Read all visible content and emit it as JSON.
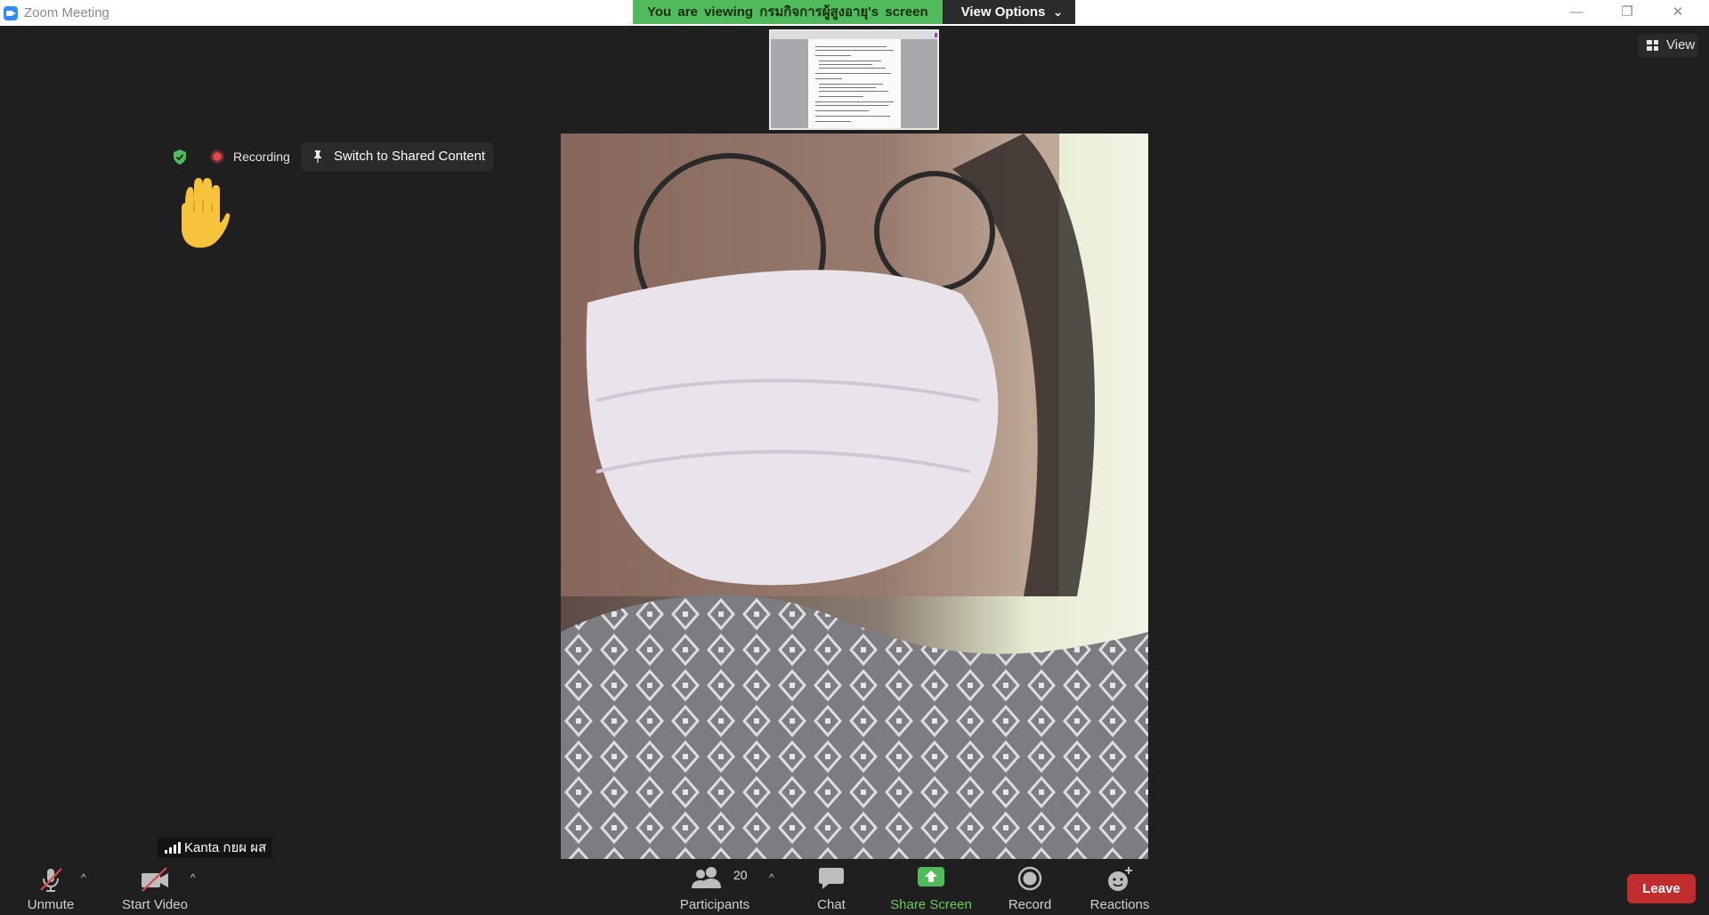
{
  "window": {
    "title": "Zoom Meeting",
    "controls": {
      "minimize": "—",
      "restore": "❐",
      "close": "✕"
    }
  },
  "share_banner": {
    "viewing_text": "You are viewing กรมกิจการผู้สูงอายุ's screen",
    "view_options_label": "View Options",
    "view_options_caret": "⌄"
  },
  "top_right": {
    "view_label": "View"
  },
  "status": {
    "recording_label": "Recording",
    "switch_label": "Switch to Shared Content"
  },
  "participant": {
    "name": "Kanta กยผ ผส"
  },
  "toolbar": {
    "unmute_label": "Unmute",
    "start_video_label": "Start Video",
    "participants_label": "Participants",
    "participants_count": "20",
    "chat_label": "Chat",
    "share_screen_label": "Share Screen",
    "record_label": "Record",
    "reactions_label": "Reactions",
    "leave_label": "Leave",
    "caret": "^"
  },
  "colors": {
    "share_green": "#4fbb5b",
    "leave_red": "#c12d2f",
    "shield_green": "#4fbb5b",
    "record_red": "#e04848"
  },
  "icons": [
    "zoom-app-icon",
    "chevron-down-icon",
    "grid-view-icon",
    "shield-check-icon",
    "record-dot-icon",
    "pin-icon",
    "raised-hand-icon",
    "signal-bars-icon",
    "muted-mic-icon",
    "video-off-icon",
    "participants-icon",
    "chat-icon",
    "share-screen-icon",
    "record-icon",
    "reactions-icon"
  ]
}
